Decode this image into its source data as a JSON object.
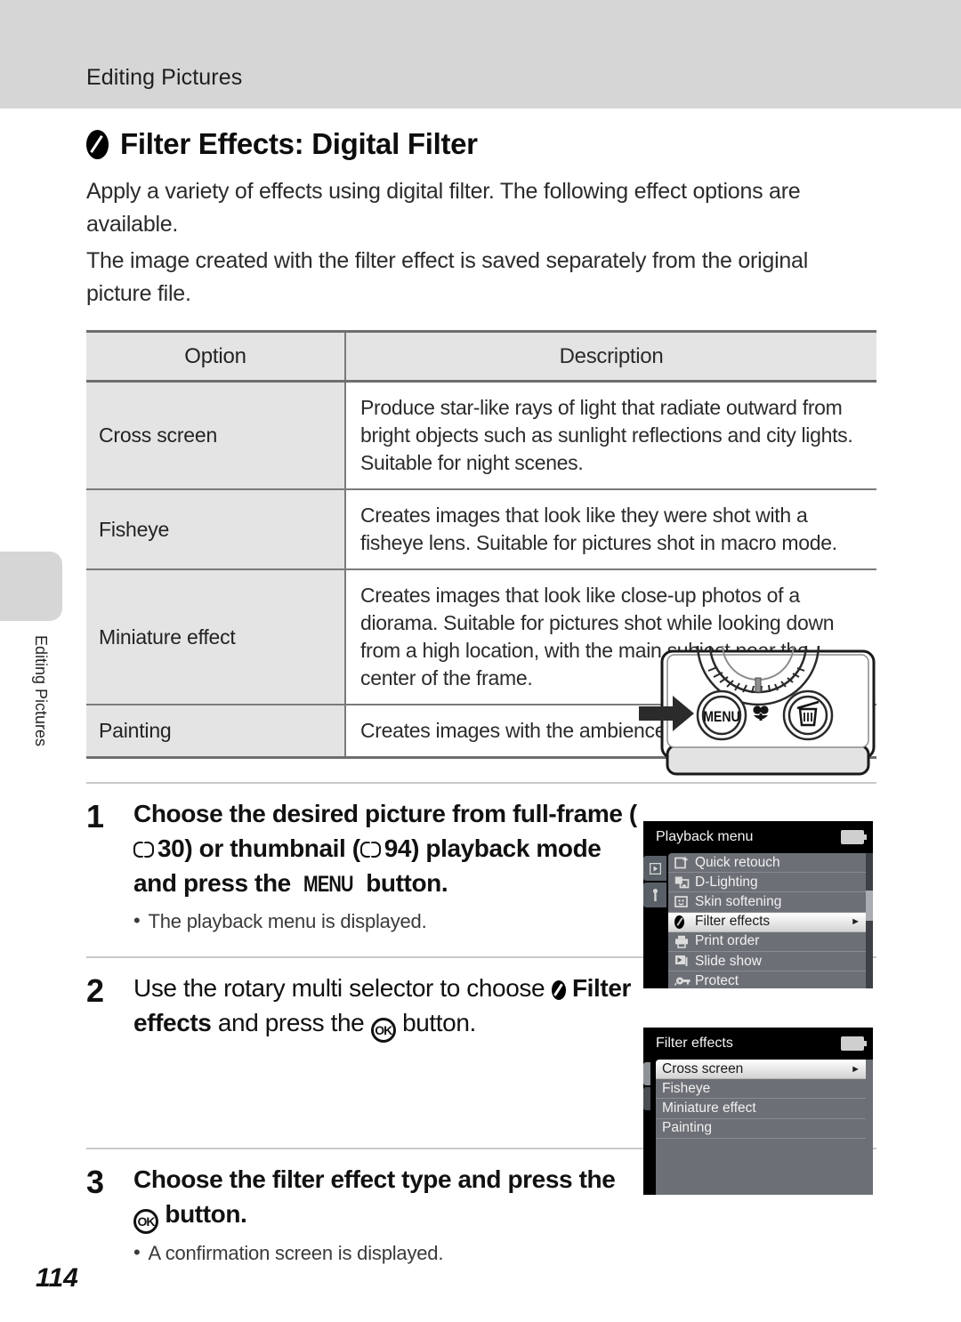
{
  "header": {
    "running_title": "Editing Pictures"
  },
  "side_tab": {
    "chapter_label": "Editing Pictures"
  },
  "section": {
    "icon": "filter-lens-icon",
    "heading": "Filter Effects: Digital Filter",
    "intro_1": "Apply a variety of effects using digital filter. The following effect options are available.",
    "intro_2": "The image created with the filter effect is saved separately from the original picture file."
  },
  "options_table": {
    "headers": [
      "Option",
      "Description"
    ],
    "rows": [
      {
        "option": "Cross screen",
        "description": "Produce star-like rays of light that radiate outward from bright objects such as sunlight reflections and city lights. Suitable for night scenes."
      },
      {
        "option": "Fisheye",
        "description": "Creates images that look like they were shot with a fisheye lens. Suitable for pictures shot in macro mode."
      },
      {
        "option": "Miniature effect",
        "description": "Creates images that look like close-up photos of a diorama. Suitable for pictures shot while looking down from a high location, with the main subject near the center of the frame."
      },
      {
        "option": "Painting",
        "description": "Creates images with the ambience of paintings."
      }
    ]
  },
  "steps": [
    {
      "number": "1",
      "title_part_1": "Choose the desired picture from full-frame (",
      "page_ref_1": "30",
      "title_part_2": ") or thumbnail (",
      "page_ref_2": "94",
      "title_part_3": ") playback mode and press the ",
      "menu_button": "MENU",
      "title_part_4": " button.",
      "bullet": "The playback menu is displayed.",
      "bullet_marker": "•"
    },
    {
      "number": "2",
      "title_part_1": "Use the rotary multi selector to choose ",
      "bold_option": "Filter effects",
      "title_part_2": " and press the ",
      "ok_button": "OK",
      "title_part_3": " button."
    },
    {
      "number": "3",
      "title_part_1": "Choose the filter effect type and press the ",
      "ok_button": "OK",
      "title_part_2": " button.",
      "bullet": "A confirmation screen is displayed.",
      "bullet_marker": "•"
    }
  ],
  "camera_figure": {
    "menu_button_label": "MENU",
    "macro_icon": "macro-flower-icon",
    "delete_icon": "trash-delete-icon",
    "arrow_icon": "pointer-arrow-icon",
    "dial_icon": "rotary-multi-selector-dial"
  },
  "lcd_playback": {
    "title": "Playback menu",
    "battery_icon": "battery-full-icon",
    "tabs": [
      {
        "name": "playback-tab",
        "glyph": "▶"
      },
      {
        "name": "setup-tab",
        "glyph": "⚙"
      }
    ],
    "items": [
      {
        "label": "Quick retouch",
        "icon": "quick-retouch-icon",
        "selected": false,
        "arrow": false
      },
      {
        "label": "D-Lighting",
        "icon": "d-lighting-icon",
        "selected": false,
        "arrow": false
      },
      {
        "label": "Skin softening",
        "icon": "skin-softening-icon",
        "selected": false,
        "arrow": false
      },
      {
        "label": "Filter effects",
        "icon": "filter-effects-icon",
        "selected": true,
        "arrow": true
      },
      {
        "label": "Print order",
        "icon": "print-order-icon",
        "selected": false,
        "arrow": false
      },
      {
        "label": "Slide show",
        "icon": "slide-show-icon",
        "selected": false,
        "arrow": false
      },
      {
        "label": "Protect",
        "icon": "protect-key-icon",
        "selected": false,
        "arrow": false
      }
    ]
  },
  "lcd_filter": {
    "title": "Filter effects",
    "battery_icon": "battery-full-icon",
    "items": [
      {
        "label": "Cross screen",
        "selected": true,
        "arrow": true
      },
      {
        "label": "Fisheye",
        "selected": false,
        "arrow": false
      },
      {
        "label": "Miniature effect",
        "selected": false,
        "arrow": false
      },
      {
        "label": "Painting",
        "selected": false,
        "arrow": false
      }
    ]
  },
  "footer": {
    "page_number": "114"
  },
  "colors": {
    "header_band": "#d6d6d6",
    "table_header_bg": "#e4e4e4",
    "lcd_bg": "#000000",
    "lcd_list_bg": "#6c7076",
    "selected_row": "#ffffff"
  }
}
